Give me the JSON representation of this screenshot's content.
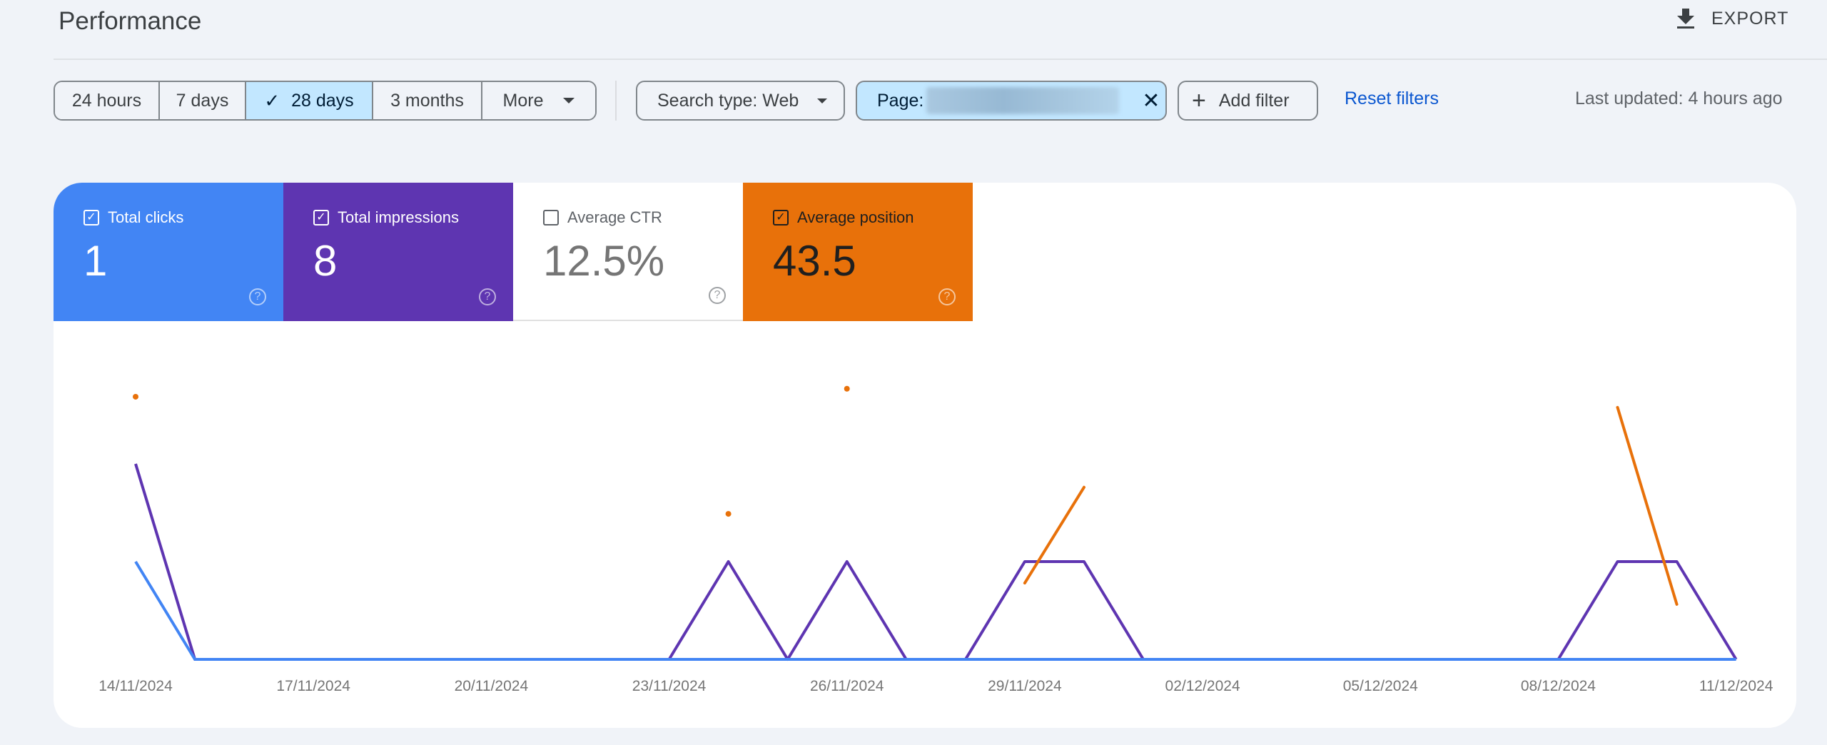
{
  "header": {
    "title": "Performance",
    "export_label": "EXPORT",
    "export_icon": "download-icon"
  },
  "date_range": {
    "options": [
      {
        "label": "24 hours",
        "active": false
      },
      {
        "label": "7 days",
        "active": false
      },
      {
        "label": "28 days",
        "active": true
      },
      {
        "label": "3 months",
        "active": false
      },
      {
        "label": "More",
        "active": false
      }
    ],
    "check_glyph": "✓"
  },
  "filters": {
    "search_type": "Search type: Web",
    "page_label": "Page:",
    "page_value_redacted": true,
    "close_glyph": "✕",
    "add_filter": "Add filter",
    "plus_glyph": "+",
    "reset": "Reset filters",
    "last_updated": "Last updated: 4 hours ago"
  },
  "metrics": [
    {
      "label": "Total clicks",
      "value": "1",
      "checked": true,
      "color": "#4285f4"
    },
    {
      "label": "Total impressions",
      "value": "8",
      "checked": true,
      "color": "#5e35b1"
    },
    {
      "label": "Average CTR",
      "value": "12.5%",
      "checked": false,
      "color": "#ffffff"
    },
    {
      "label": "Average position",
      "value": "43.5",
      "checked": true,
      "color": "#e8710a"
    }
  ],
  "help_glyph": "?",
  "chart_data": {
    "type": "line",
    "x": [
      "14/11/2024",
      "15/11/2024",
      "16/11/2024",
      "17/11/2024",
      "18/11/2024",
      "19/11/2024",
      "20/11/2024",
      "21/11/2024",
      "22/11/2024",
      "23/11/2024",
      "24/11/2024",
      "25/11/2024",
      "26/11/2024",
      "27/11/2024",
      "28/11/2024",
      "29/11/2024",
      "30/11/2024",
      "01/12/2024",
      "02/12/2024",
      "03/12/2024",
      "04/12/2024",
      "05/12/2024",
      "06/12/2024",
      "07/12/2024",
      "08/12/2024",
      "09/12/2024",
      "10/12/2024",
      "11/12/2024"
    ],
    "tick_labels": [
      "14/11/2024",
      "17/11/2024",
      "20/11/2024",
      "23/11/2024",
      "26/11/2024",
      "29/11/2024",
      "02/12/2024",
      "05/12/2024",
      "08/12/2024",
      "11/12/2024"
    ],
    "series": [
      {
        "name": "Clicks",
        "color": "#4285f4",
        "values": [
          1,
          0,
          0,
          0,
          0,
          0,
          0,
          0,
          0,
          0,
          0,
          0,
          0,
          0,
          0,
          0,
          0,
          0,
          0,
          0,
          0,
          0,
          0,
          0,
          0,
          0,
          0,
          0
        ]
      },
      {
        "name": "Impressions",
        "color": "#5e35b1",
        "values": [
          2,
          0,
          0,
          0,
          0,
          0,
          0,
          0,
          0,
          0,
          1,
          0,
          1,
          0,
          0,
          1,
          1,
          0,
          0,
          0,
          0,
          0,
          0,
          0,
          0,
          1,
          1,
          0
        ]
      },
      {
        "name": "Position",
        "color": "#e8710a",
        "inverted": true,
        "values": [
          15,
          null,
          null,
          null,
          null,
          null,
          null,
          null,
          null,
          null,
          59,
          null,
          12,
          null,
          null,
          85,
          49,
          null,
          null,
          null,
          null,
          null,
          null,
          null,
          null,
          19,
          93,
          null
        ]
      }
    ],
    "ylim_counts": [
      0,
      2
    ],
    "ylim_position": [
      0,
      100
    ],
    "grid": false,
    "legend": "none"
  }
}
